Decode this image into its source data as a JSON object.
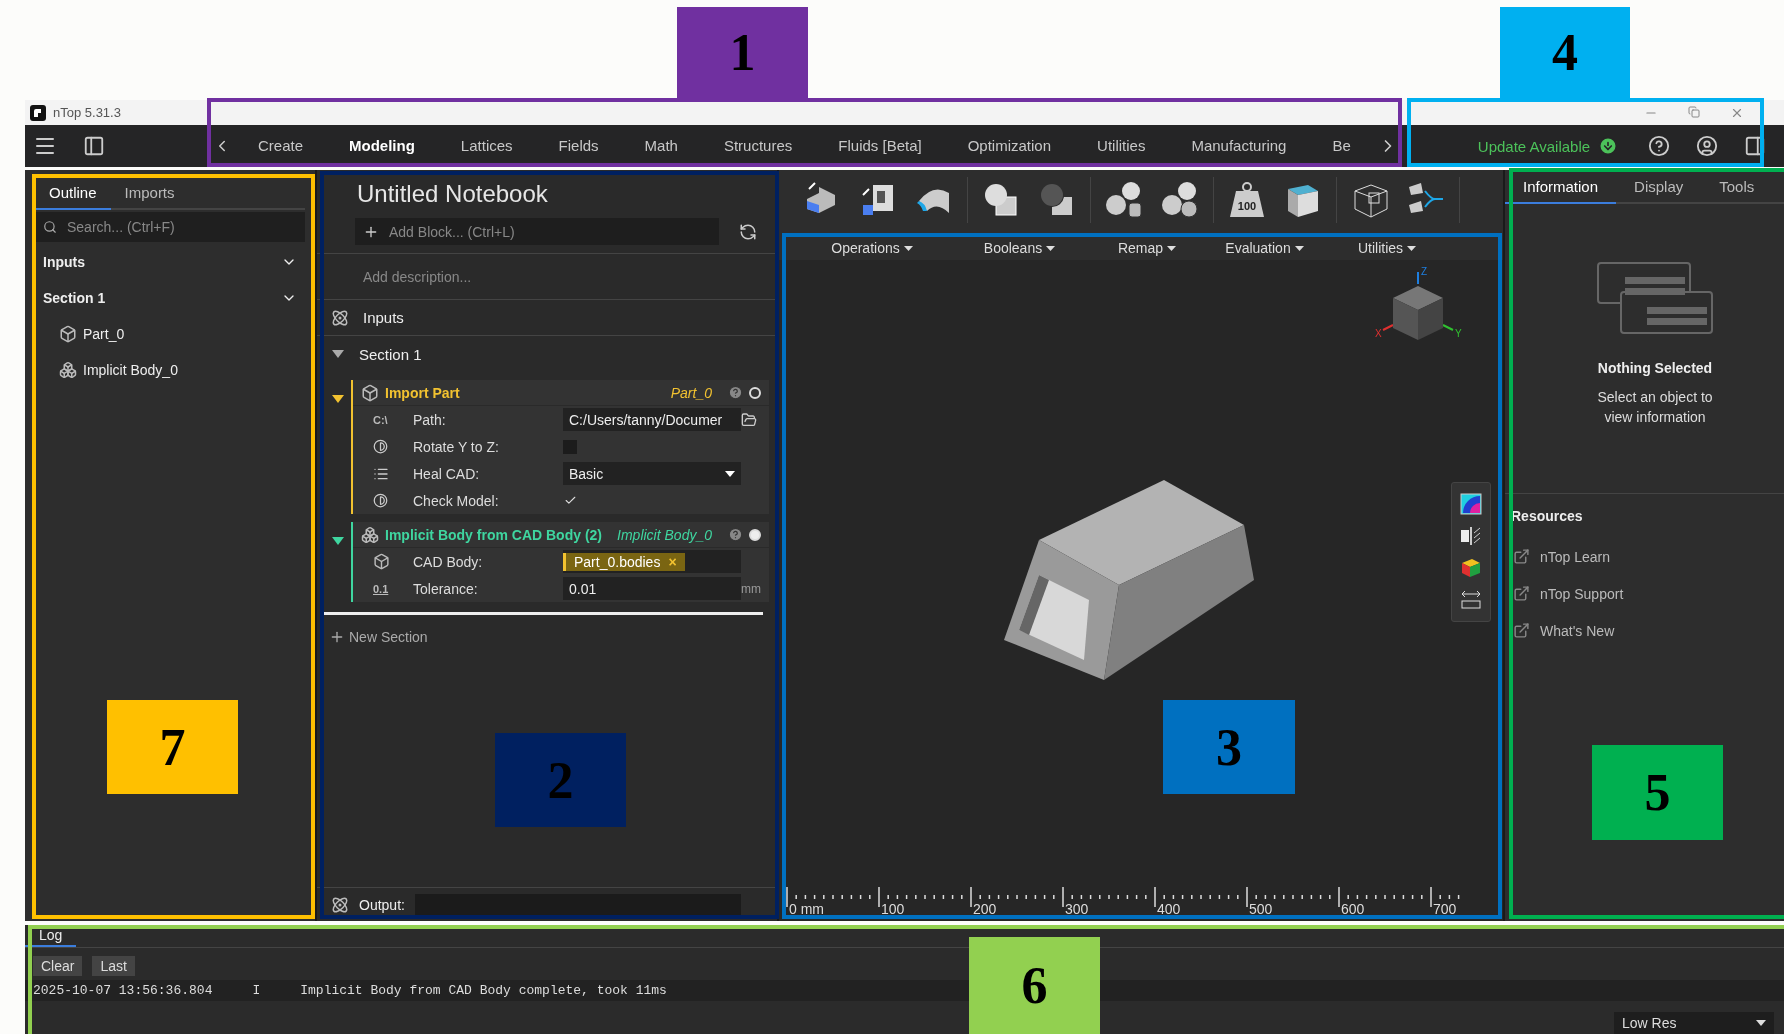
{
  "window": {
    "title": "nTop 5.31.3"
  },
  "ribbon": {
    "tabs": [
      {
        "label": "Create",
        "selected": false
      },
      {
        "label": "Modeling",
        "selected": true
      },
      {
        "label": "Lattices",
        "selected": false
      },
      {
        "label": "Fields",
        "selected": false
      },
      {
        "label": "Math",
        "selected": false
      },
      {
        "label": "Structures",
        "selected": false
      },
      {
        "label": "Fluids [Beta]",
        "selected": false
      },
      {
        "label": "Optimization",
        "selected": false
      },
      {
        "label": "Utilities",
        "selected": false
      },
      {
        "label": "Manufacturing",
        "selected": false
      },
      {
        "label": "Be",
        "selected": false
      }
    ],
    "update": "Update Available"
  },
  "outline": {
    "tabs": [
      {
        "label": "Outline",
        "selected": true
      },
      {
        "label": "Imports",
        "selected": false
      }
    ],
    "search": {
      "placeholder": "Search... (Ctrl+F)"
    },
    "groups": [
      {
        "label": "Inputs",
        "expanded": true
      },
      {
        "label": "Section 1",
        "expanded": true,
        "children": [
          {
            "label": "Part_0",
            "kind": "part"
          },
          {
            "label": "Implicit Body_0",
            "kind": "implicit"
          }
        ]
      }
    ]
  },
  "notebook": {
    "title": "Untitled Notebook",
    "add_block": {
      "placeholder": "Add Block... (Ctrl+L)"
    },
    "description": {
      "placeholder": "Add description..."
    },
    "inputs": "Inputs",
    "section": {
      "label": "Section 1",
      "expanded": true,
      "blocks": [
        {
          "title": "Import Part",
          "output": "Part_0",
          "color": "#f2c230",
          "expanded": true,
          "shown": false,
          "kind": "part",
          "params": [
            {
              "label": "Path:",
              "kind": "path",
              "icon_text": "C:\\",
              "value": "C:/Users/tanny/Documer"
            },
            {
              "label": "Rotate Y to Z:",
              "kind": "checkbox",
              "checked": false
            },
            {
              "label": "Heal CAD:",
              "kind": "dropdown",
              "value": "Basic"
            },
            {
              "label": "Check Model:",
              "kind": "checkbox",
              "checked": true
            }
          ]
        },
        {
          "title": "Implicit Body from CAD Body (2)",
          "output": "Implicit Body_0",
          "color": "#3fd6a0",
          "expanded": true,
          "shown": true,
          "kind": "implicit",
          "params": [
            {
              "label": "CAD Body:",
              "kind": "chip",
              "value": "Part_0.bodies",
              "remove": "×"
            },
            {
              "label": "Tolerance:",
              "kind": "number",
              "icon_text": "0.1",
              "value": "0.01",
              "unit": "mm"
            }
          ]
        }
      ]
    },
    "new_section": "New Section",
    "output": {
      "label": "Output:"
    }
  },
  "viewport": {
    "toolbar": [
      {
        "menu": "Operations",
        "tools": [
          {
            "kind": "step"
          },
          {
            "kind": "corner"
          },
          {
            "kind": "bend"
          }
        ]
      },
      {
        "menu": "Booleans",
        "tools": [
          {
            "kind": "union"
          },
          {
            "kind": "subtract"
          }
        ]
      },
      {
        "menu": "Remap",
        "tools": [
          {
            "kind": "blob-cylinder"
          },
          {
            "kind": "blob-sphere"
          }
        ]
      },
      {
        "menu": "Evaluation",
        "tools": [
          {
            "kind": "weight",
            "label": "100"
          },
          {
            "kind": "cube"
          }
        ]
      },
      {
        "menu": "Utilities",
        "tools": [
          {
            "kind": "wire-cube"
          },
          {
            "kind": "merge"
          }
        ]
      }
    ],
    "axes": [
      "Z",
      "X",
      "Y"
    ],
    "ruler": [
      "0 mm",
      "100",
      "200",
      "300",
      "400",
      "500",
      "600",
      "700"
    ]
  },
  "info": {
    "tabs": [
      {
        "label": "Information",
        "selected": true
      },
      {
        "label": "Display",
        "selected": false
      },
      {
        "label": "Tools",
        "selected": false
      }
    ],
    "empty_title": "Nothing Selected",
    "empty_text": "Select an object to view information",
    "resources_title": "Resources",
    "resources": [
      "nTop Learn",
      "nTop Support",
      "What's New"
    ]
  },
  "log": {
    "tab": "Log",
    "buttons": [
      "Clear",
      "Last"
    ],
    "entries": [
      {
        "time": "2025-10-07 13:56:36.804",
        "level": "I",
        "message": "Implicit Body from CAD Body complete, took 11ms"
      }
    ],
    "resolution": "Low Res"
  },
  "annotations": [
    {
      "label": "1",
      "color": "#7030a0"
    },
    {
      "label": "4",
      "color": "#00b0f0"
    },
    {
      "label": "7",
      "color": "#ffc000"
    },
    {
      "label": "2",
      "color": "#002060"
    },
    {
      "label": "3",
      "color": "#0070c0"
    },
    {
      "label": "5",
      "color": "#00b050"
    },
    {
      "label": "6",
      "color": "#92d050"
    }
  ]
}
